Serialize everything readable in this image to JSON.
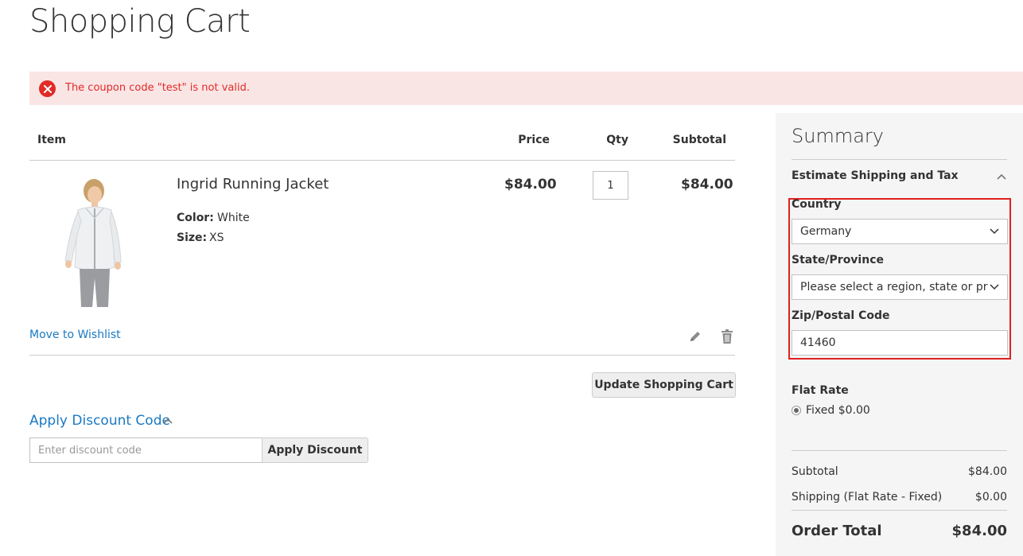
{
  "page": {
    "title": "Shopping Cart"
  },
  "error": {
    "message": "The coupon code \"test\" is not valid."
  },
  "cart": {
    "headers": {
      "item": "Item",
      "price": "Price",
      "qty": "Qty",
      "subtotal": "Subtotal"
    },
    "item": {
      "name": "Ingrid Running Jacket",
      "options": [
        {
          "label": "Color:",
          "value": "White"
        },
        {
          "label": "Size:",
          "value": "XS"
        }
      ],
      "price": "$84.00",
      "qty": "1",
      "subtotal": "$84.00"
    },
    "wishlist_link": "Move to Wishlist",
    "update_button": "Update Shopping Cart"
  },
  "discount": {
    "title": "Apply Discount Code",
    "placeholder": "Enter discount code",
    "apply_button": "Apply Discount"
  },
  "summary": {
    "title": "Summary",
    "estimate_title": "Estimate Shipping and Tax",
    "country_label": "Country",
    "country_value": "Germany",
    "state_label": "State/Province",
    "state_value": "Please select a region, state or province.",
    "zip_label": "Zip/Postal Code",
    "zip_value": "41460",
    "flat_rate_title": "Flat Rate",
    "flat_rate_option": "Fixed $0.00",
    "subtotal_label": "Subtotal",
    "subtotal_value": "$84.00",
    "shipping_label": "Shipping (Flat Rate - Fixed)",
    "shipping_value": "$0.00",
    "order_total_label": "Order Total",
    "order_total_value": "$84.00"
  },
  "colors": {
    "link": "#1979c3",
    "error_bg": "#fae5e5",
    "error_text": "#e02b27",
    "highlight": "#e02020",
    "summary_bg": "#f5f5f5"
  }
}
